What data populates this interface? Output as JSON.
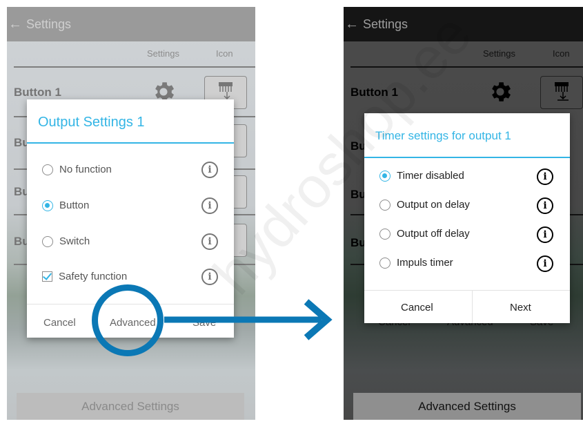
{
  "left": {
    "appbar": {
      "back": "←",
      "title": "Settings"
    },
    "columns": {
      "settings": "Settings",
      "icon": "Icon"
    },
    "button_label": "Button 1",
    "partial_labels": [
      "Bu",
      "Bu",
      "Bu"
    ],
    "dialog": {
      "title": "Output Settings 1",
      "options": [
        {
          "label": "No function",
          "type": "radio",
          "selected": false
        },
        {
          "label": "Button",
          "type": "radio",
          "selected": true
        },
        {
          "label": "Switch",
          "type": "radio",
          "selected": false
        },
        {
          "label": "Safety function",
          "type": "checkbox",
          "selected": true
        }
      ],
      "buttons": {
        "cancel": "Cancel",
        "advanced": "Advanced",
        "save": "Save"
      }
    },
    "advanced_bar": "Advanced Settings"
  },
  "right": {
    "appbar": {
      "back": "←",
      "title": "Settings"
    },
    "columns": {
      "settings": "Settings",
      "icon": "Icon"
    },
    "button_label": "Button 1",
    "partial_labels": [
      "Bu",
      "Bu",
      "Bu"
    ],
    "behind_buttons": {
      "cancel": "Cancel",
      "advanced": "Advanced",
      "save": "Save"
    },
    "dialog": {
      "title": "Timer settings for output 1",
      "options": [
        {
          "label": "Timer disabled",
          "type": "radio",
          "selected": true
        },
        {
          "label": "Output on delay",
          "type": "radio",
          "selected": false
        },
        {
          "label": "Output off delay",
          "type": "radio",
          "selected": false
        },
        {
          "label": "Impuls timer",
          "type": "radio",
          "selected": false
        }
      ],
      "buttons": {
        "cancel": "Cancel",
        "next": "Next"
      }
    },
    "advanced_bar": "Advanced Settings"
  },
  "info_glyph": "i",
  "watermark": "hydroshop.ee",
  "colors": {
    "accent": "#33b5e5",
    "annotation": "#0b78b5"
  },
  "icons": [
    "back-arrow-icon",
    "gear-icon",
    "output-icon",
    "info-icon",
    "arrow-annotation"
  ]
}
